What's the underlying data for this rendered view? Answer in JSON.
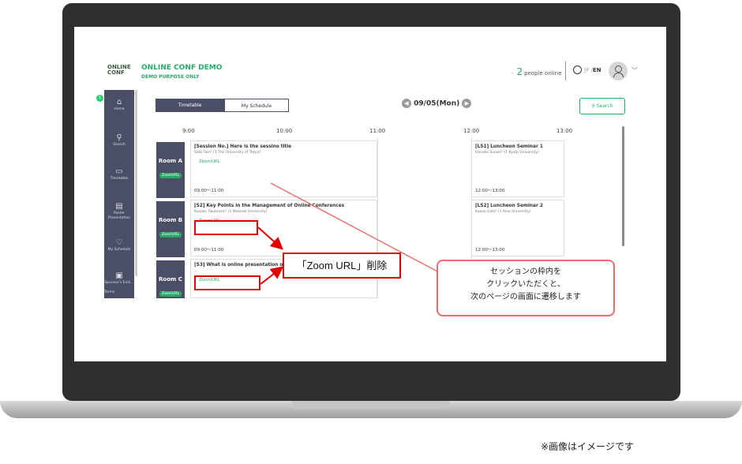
{
  "header": {
    "logo_line1": "ONLINE",
    "logo_line2": "CONF",
    "conf_title": "ONLINE CONF DEMO",
    "conf_subtitle": "DEMO PURPOSE ONLY",
    "online_count": "2",
    "online_label": "people online",
    "lang_jp": "JP /",
    "lang_en": "EN"
  },
  "sidebar": {
    "badge": "1",
    "items": [
      {
        "label": "Home",
        "icon": "home-icon",
        "glyph": "⌂"
      },
      {
        "label": "Search",
        "icon": "search-icon",
        "glyph": "⚲"
      },
      {
        "label": "Timetable",
        "icon": "monitor-icon",
        "glyph": "▭"
      },
      {
        "label": "Poster Presentation",
        "icon": "poster-icon",
        "glyph": "▤"
      },
      {
        "label": "My Schedule",
        "icon": "heart-icon",
        "glyph": "♡"
      },
      {
        "label": "Sponsor's Exhi...",
        "icon": "sponsor-icon",
        "glyph": "▣"
      }
    ],
    "terms": "Terms"
  },
  "tabs": {
    "timetable": "Timetable",
    "my_schedule": "My Schedule"
  },
  "date_label": "09/05(Mon)",
  "search_label": "Search",
  "times": [
    "9:00",
    "10:00",
    "11:00",
    "12:00",
    "13:00"
  ],
  "rooms": [
    {
      "name": "Room A",
      "zoom": "ZoomURL"
    },
    {
      "name": "Room B",
      "zoom": "ZoomURL"
    },
    {
      "name": "Room C",
      "zoom": "ZoomURL"
    }
  ],
  "sessions": [
    {
      "title": "[Session No.] Here is the sessino title",
      "speaker": "Sato Taro¹ (1 The University of Tokyo)",
      "zoom": "ZoomURL",
      "time": "09:00～11:00"
    },
    {
      "title": "[S2] Key Points in the Management of Online Conferences",
      "speaker": "Kazuko Takahashi¹ (1 Waseda University)",
      "zoom": "ZoomURL",
      "time": "09:00～11:00"
    },
    {
      "title": "[S3] What is online presentation of ...",
      "speaker": "...",
      "zoom": "ZoomURL",
      "time": ""
    },
    {
      "title": "[LS1] Luncheon Seminar 1",
      "speaker": "Hanako Suzuki¹ (1 Kyoto University)",
      "zoom": "",
      "time": "12:00～13:00"
    },
    {
      "title": "[LS2] Luncheon Seminar 2",
      "speaker": "Kazuo Goto¹ (1 Keio University)",
      "zoom": "",
      "time": "12:00～13:00"
    }
  ],
  "annotations": {
    "callout_zoom": "「Zoom URL」削除",
    "callout_click_line1": "セッションの枠内を",
    "callout_click_line2": "クリックいただくと、",
    "callout_click_line3": "次のページの画面に遷移します"
  },
  "footnote": "※画像はイメージです",
  "colors": {
    "accent": "#2aa86a",
    "sidebar": "#4a4f66",
    "annotation": "#e10000"
  }
}
